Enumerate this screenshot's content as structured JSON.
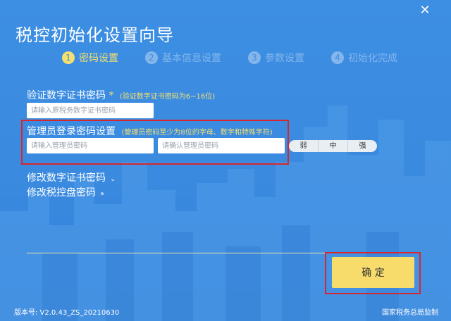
{
  "window": {
    "title": "税控初始化设置向导",
    "close_icon": "close-icon"
  },
  "steps": [
    {
      "num": "1",
      "label": "密码设置",
      "state": "active"
    },
    {
      "num": "2",
      "label": "基本信息设置",
      "state": "inactive"
    },
    {
      "num": "3",
      "label": "参数设置",
      "state": "inactive"
    },
    {
      "num": "4",
      "label": "初始化完成",
      "state": "inactive"
    }
  ],
  "cert_password": {
    "label": "验证数字证书密码",
    "required_mark": "*",
    "hint": "(验证数字证书密码为6~16位)",
    "placeholder": "请输入原税务数字证书密码",
    "value": ""
  },
  "admin_password": {
    "label": "管理员登录密码设置",
    "hint": "(管理员密码至少为8位的字母、数字和特殊字符)",
    "input_placeholder": "请输入管理员密码",
    "confirm_placeholder": "请确认管理员密码",
    "value": "",
    "confirm_value": ""
  },
  "strength": [
    "弱",
    "中",
    "强"
  ],
  "expanders": {
    "modify_cert": "修改数字证书密码",
    "modify_disk": "修改税控盘密码"
  },
  "confirm_label": "确 定",
  "footer": {
    "version": "版本号: V2.0.43_ZS_20210630",
    "supervisor": "国家税务总局监制"
  },
  "colors": {
    "background": "#3d8fe3",
    "accent_yellow": "#f6e06d",
    "highlight_red": "#d9262c",
    "button_yellow": "#f7dc6b"
  }
}
